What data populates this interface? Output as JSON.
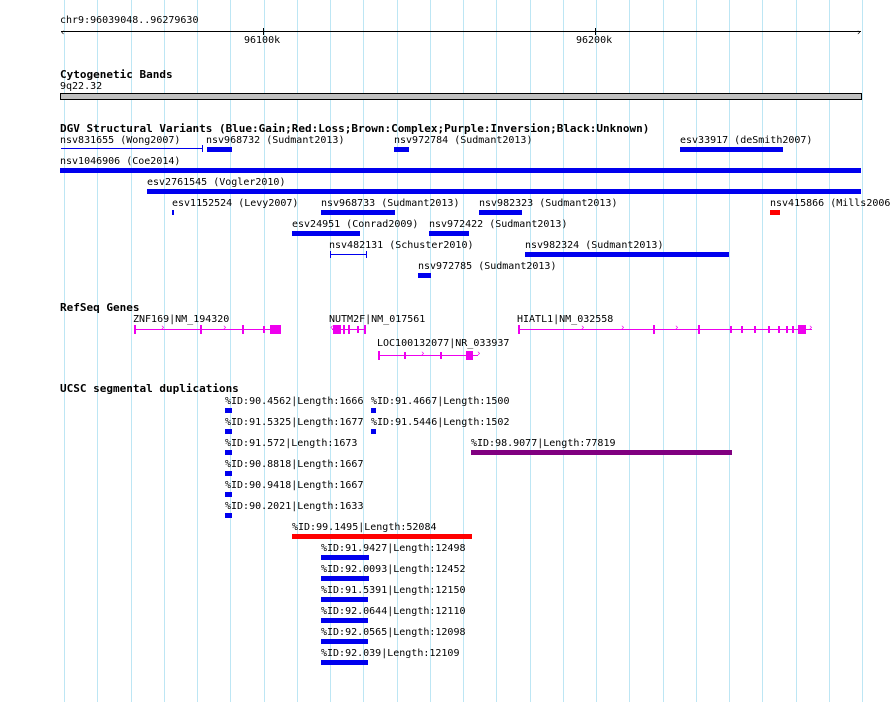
{
  "ruler": {
    "position": "chr9:96039048..96279630",
    "tick_labels": [
      {
        "value": 96100000,
        "label": "96100k"
      },
      {
        "value": 96200000,
        "label": "96200k"
      }
    ]
  },
  "tracks": {
    "cytoband": {
      "title": "Cytogenetic Bands",
      "band": "9q22.32"
    },
    "dgv": {
      "title": "DGV Structural Variants (Blue:Gain;Red:Loss;Brown:Complex;Purple:Inversion;Black:Unknown)",
      "colors": {
        "gain": "#0000ee",
        "loss": "#ff0000"
      },
      "features": [
        {
          "label": "nsv831655 (Wong2007)",
          "style": "line",
          "color": "#0000ee"
        },
        {
          "label": "nsv968732 (Sudmant2013)",
          "style": "bar",
          "color": "#0000ee"
        },
        {
          "label": "nsv972784 (Sudmant2013)",
          "style": "bar",
          "color": "#0000ee"
        },
        {
          "label": "esv33917 (deSmith2007)",
          "style": "bar",
          "color": "#0000ee"
        },
        {
          "label": "nsv1046906 (Coe2014)",
          "style": "bar",
          "color": "#0000ee"
        },
        {
          "label": "esv2761545 (Vogler2010)",
          "style": "bar",
          "color": "#0000ee"
        },
        {
          "label": "esv1152524 (Levy2007)",
          "style": "bar",
          "color": "#0000ee"
        },
        {
          "label": "nsv968733 (Sudmant2013)",
          "style": "bar",
          "color": "#0000ee"
        },
        {
          "label": "nsv982323 (Sudmant2013)",
          "style": "bar",
          "color": "#0000ee"
        },
        {
          "label": "nsv415866 (Mills2006",
          "style": "bar",
          "color": "#ff0000"
        },
        {
          "label": "esv24951 (Conrad2009)",
          "style": "bar",
          "color": "#0000ee"
        },
        {
          "label": "nsv972422 (Sudmant2013)",
          "style": "bar",
          "color": "#0000ee"
        },
        {
          "label": "nsv482131 (Schuster2010)",
          "style": "line",
          "color": "#0000ee"
        },
        {
          "label": "nsv982324 (Sudmant2013)",
          "style": "bar",
          "color": "#0000ee"
        },
        {
          "label": "nsv972785 (Sudmant2013)",
          "style": "bar",
          "color": "#0000ee"
        }
      ]
    },
    "refseq": {
      "title": "RefSeq Genes",
      "color": "#ee00ee",
      "genes": [
        {
          "label": "ZNF169|NM_194320",
          "strand": "+"
        },
        {
          "label": "NUTM2F|NM_017561",
          "strand": "-"
        },
        {
          "label": "HIATL1|NM_032558",
          "strand": "+"
        },
        {
          "label": "LOC100132077|NR_033937",
          "strand": "+"
        }
      ]
    },
    "segdups": {
      "title": "UCSC segmental duplications",
      "features": [
        {
          "label": "%ID:90.4562|Length:1666",
          "color": "#0000ee"
        },
        {
          "label": "%ID:91.4667|Length:1500",
          "color": "#0000ee"
        },
        {
          "label": "%ID:91.5325|Length:1677",
          "color": "#0000ee"
        },
        {
          "label": "%ID:91.5446|Length:1502",
          "color": "#0000ee"
        },
        {
          "label": "%ID:91.572|Length:1673",
          "color": "#0000ee"
        },
        {
          "label": "%ID:98.9077|Length:77819",
          "color": "#800080"
        },
        {
          "label": "%ID:90.8818|Length:1667",
          "color": "#0000ee"
        },
        {
          "label": "%ID:90.9418|Length:1667",
          "color": "#0000ee"
        },
        {
          "label": "%ID:90.2021|Length:1633",
          "color": "#0000ee"
        },
        {
          "label": "%ID:99.1495|Length:52084",
          "color": "#ff0000"
        },
        {
          "label": "%ID:91.9427|Length:12498",
          "color": "#0000ee"
        },
        {
          "label": "%ID:92.0093|Length:12452",
          "color": "#0000ee"
        },
        {
          "label": "%ID:91.5391|Length:12150",
          "color": "#0000ee"
        },
        {
          "label": "%ID:92.0644|Length:12110",
          "color": "#0000ee"
        },
        {
          "label": "%ID:92.0565|Length:12098",
          "color": "#0000ee"
        },
        {
          "label": "%ID:92.039|Length:12109",
          "color": "#0000ee"
        }
      ]
    }
  },
  "colors": {
    "grid": "#bde6f4",
    "band": "#c0c0c0",
    "gain": "#0000ee",
    "loss": "#ff0000",
    "inversion_like": "#800080",
    "gene": "#ee00ee"
  }
}
